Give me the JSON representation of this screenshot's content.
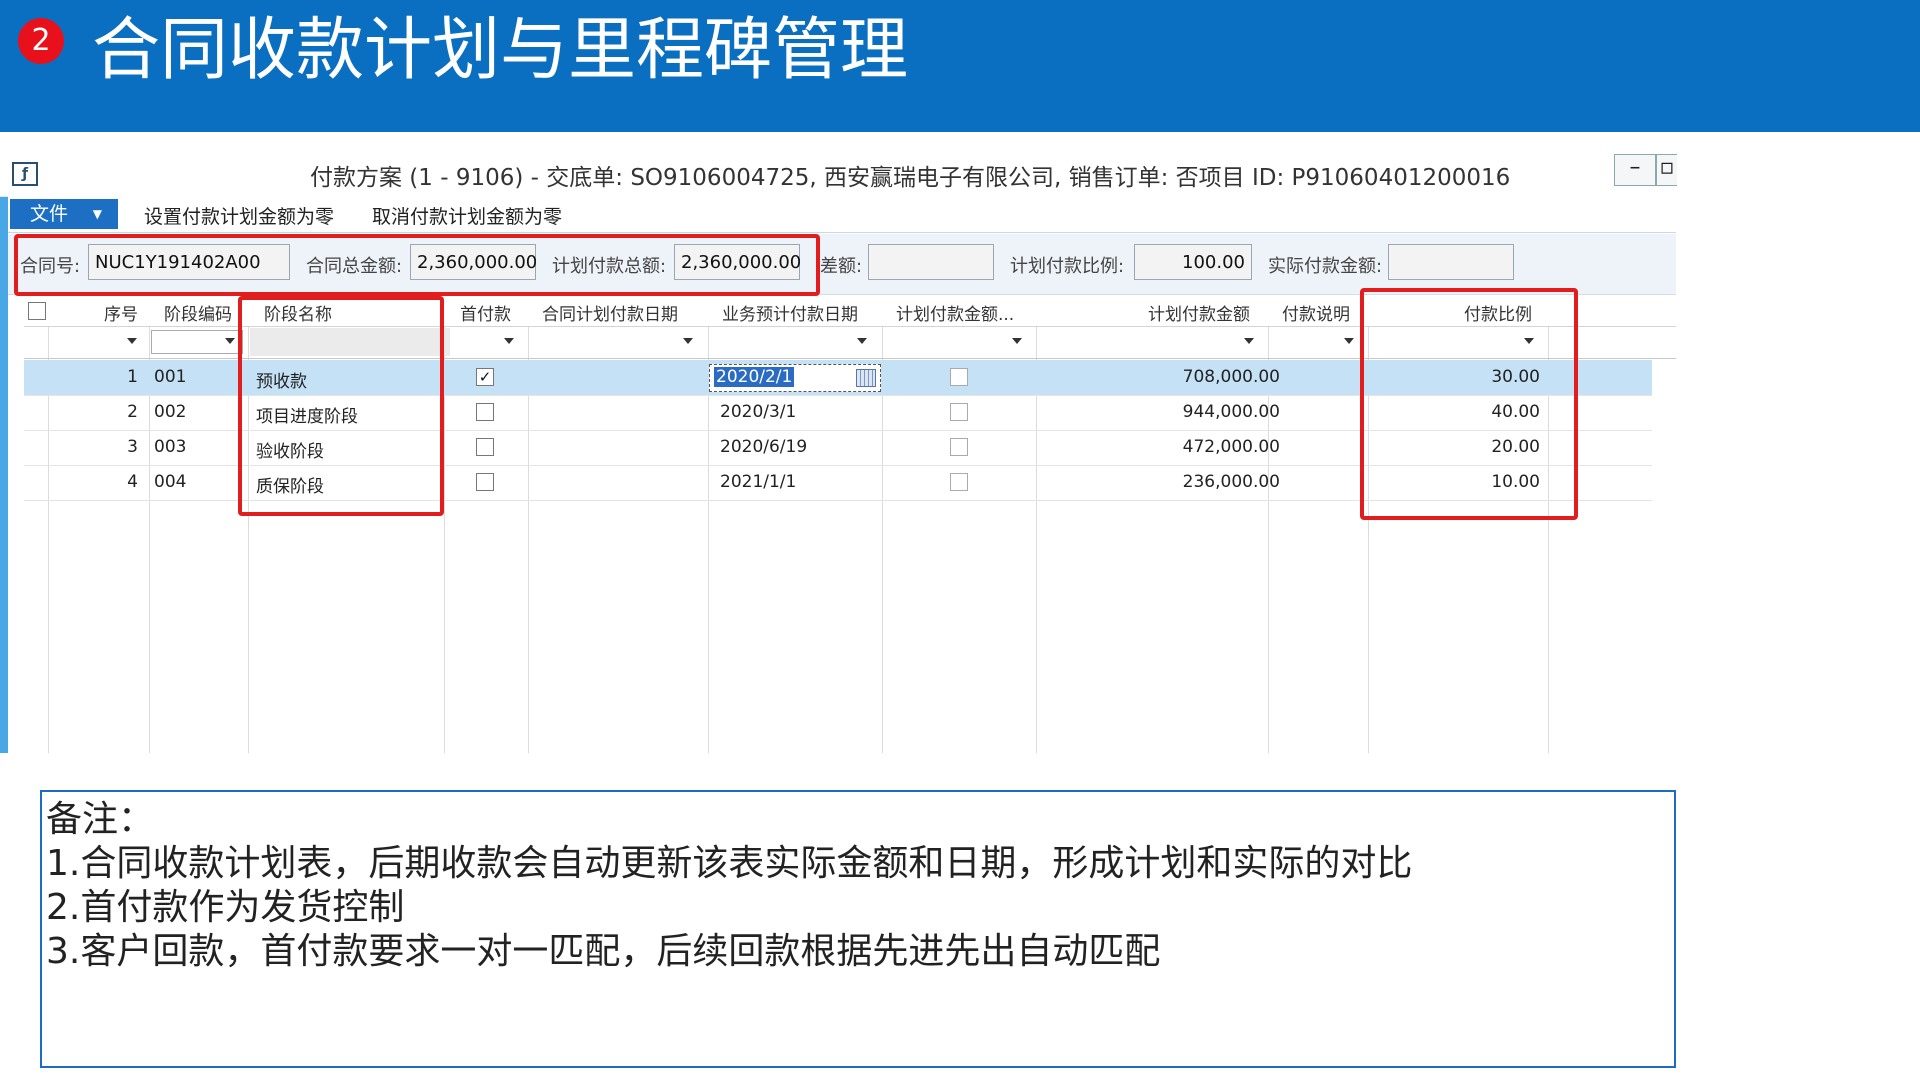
{
  "slide": {
    "step_badge": "2",
    "title": "合同收款计划与里程碑管理"
  },
  "window": {
    "app_icon": "app-window-icon",
    "title": "付款方案 (1 - 9106) - 交底单: SO9106004725, 西安赢瑞电子有限公司, 销售订单: 否项目 ID: P91060401200016",
    "minimize": "–",
    "restore": "▫"
  },
  "menu": {
    "file": "文件",
    "set_zero": "设置付款计划金额为零",
    "cancel_zero": "取消付款计划金额为零"
  },
  "fields": {
    "contract_no_label": "合同号:",
    "contract_no_value": "NUC1Y191402A00",
    "total_amount_label": "合同总金额:",
    "total_amount_value": "2,360,000.00",
    "plan_total_label": "计划付款总额:",
    "plan_total_value": "2,360,000.00",
    "diff_label": "差额:",
    "diff_value": "",
    "plan_ratio_label": "计划付款比例:",
    "plan_ratio_value": "100.00",
    "actual_amount_label": "实际付款金额:",
    "actual_amount_value": ""
  },
  "grid": {
    "headers": {
      "seq": "序号",
      "code": "阶段编码",
      "name": "阶段名称",
      "first": "首付款",
      "contract_date": "合同计划付款日期",
      "biz_date": "业务预计付款日期",
      "plan_amount_flag": "计划付款金额...",
      "plan_amount": "计划付款金额",
      "note": "付款说明",
      "ratio": "付款比例"
    },
    "rows": [
      {
        "seq": "1",
        "code": "001",
        "name": "预收款",
        "first": true,
        "biz_date": "2020/2/1",
        "plan_amount": "708,000.00",
        "ratio": "30.00"
      },
      {
        "seq": "2",
        "code": "002",
        "name": "项目进度阶段",
        "first": false,
        "biz_date": "2020/3/1",
        "plan_amount": "944,000.00",
        "ratio": "40.00"
      },
      {
        "seq": "3",
        "code": "003",
        "name": "验收阶段",
        "first": false,
        "biz_date": "2020/6/19",
        "plan_amount": "472,000.00",
        "ratio": "20.00"
      },
      {
        "seq": "4",
        "code": "004",
        "name": "质保阶段",
        "first": false,
        "biz_date": "2021/1/1",
        "plan_amount": "236,000.00",
        "ratio": "10.00"
      }
    ]
  },
  "notes": {
    "title": "备注：",
    "lines": [
      "1.合同收款计划表，后期收款会自动更新该表实际金额和日期，形成计划和实际的对比",
      "2.首付款作为发货控制",
      "3.客户回款，首付款要求一对一匹配，后续回款根据先进先出自动匹配"
    ]
  },
  "colors": {
    "header_blue": "#0a6fc1",
    "highlight_red": "#e11d1d",
    "selected_row": "#c5e1f6"
  }
}
